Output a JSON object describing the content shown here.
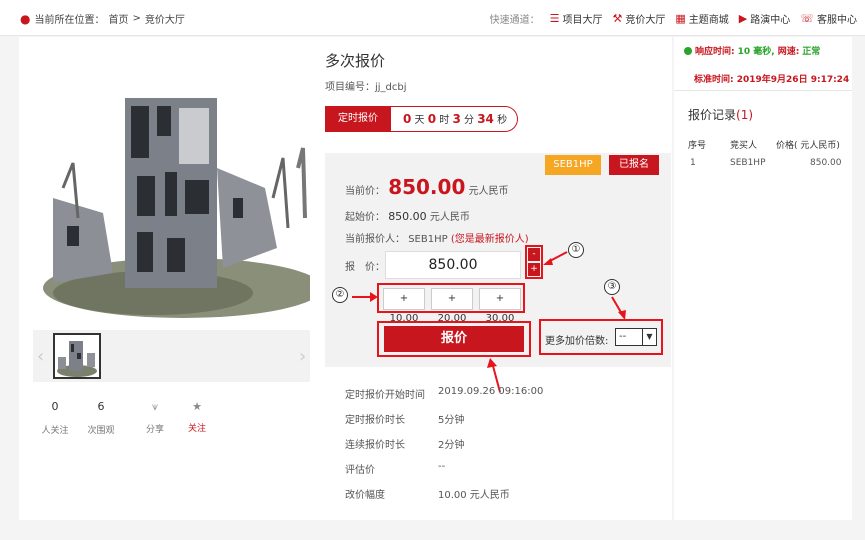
{
  "breadcrumb": {
    "prefix": "当前所在位置：",
    "home": "首页",
    "sep": ">",
    "current": "竞价大厅"
  },
  "quick": {
    "label": "快速通道：",
    "items": [
      {
        "label": "项目大厅",
        "icon": "list-icon"
      },
      {
        "label": "竞价大厅",
        "icon": "gavel-icon"
      },
      {
        "label": "主题商城",
        "icon": "grid-icon"
      },
      {
        "label": "路演中心",
        "icon": "play-icon"
      },
      {
        "label": "客服中心",
        "icon": "headset-icon"
      }
    ]
  },
  "product": {
    "title": "多次报价",
    "project_id": "项目编号：jj_dcbj",
    "timer_label": "定时报价",
    "timer": {
      "d": "0",
      "d_unit": "天",
      "h": "0",
      "h_unit": "时",
      "m": "3",
      "m_unit": "分",
      "s": "34",
      "s_unit": "秒"
    }
  },
  "stats": [
    {
      "num": "0",
      "label": "人关注"
    },
    {
      "num": "6",
      "label": "次围观"
    },
    {
      "num": "",
      "label": "分享"
    },
    {
      "num": "",
      "label": "关注"
    }
  ],
  "bid": {
    "user_tag": "SEB1HP",
    "status_tag": "已报名",
    "current_label": "当前价：",
    "current_price": "850.00",
    "current_unit": "元人民币",
    "start_label": "起始价：",
    "start_price": "850.00",
    "start_unit": "元人民币",
    "bidder_label": "当前报价人：",
    "bidder": "SEB1HP",
    "bidder_note": "(您是最新报价人)",
    "price_label": "报　价：",
    "price_value": "850.00",
    "minus": "-",
    "plus": "+",
    "increments": [
      "+ 10.00",
      "+ 20.00",
      "+ 30.00"
    ],
    "bid_button": "报价",
    "multiplier_label": "更多加价倍数:",
    "multiplier_value": "--"
  },
  "annotations": [
    "①",
    "②",
    "③"
  ],
  "details": [
    {
      "label": "定时报价开始时间",
      "value": "2019.09.26 09:16:00"
    },
    {
      "label": "定时报价时长",
      "value": "5分钟"
    },
    {
      "label": "连续报价时长",
      "value": "2分钟"
    },
    {
      "label": "评估价",
      "value": "--"
    },
    {
      "label": "改价幅度",
      "value": "10.00 元人民币"
    }
  ],
  "status": {
    "resp_label": "响应时间:",
    "resp_value": "10 毫秒,",
    "net_label": "网速:",
    "net_value": "正常",
    "std_time": "标准时间: 2019年9月26日 9:17:24"
  },
  "records": {
    "title": "报价记录",
    "count": "(1)",
    "headers": [
      "序号",
      "竞买人",
      "价格( 元人民币)"
    ],
    "rows": [
      [
        "1",
        "SEB1HP",
        "850.00"
      ]
    ]
  },
  "colors": {
    "accent": "#c8161e",
    "tag": "#f5a623",
    "ok": "#2aa52a"
  }
}
